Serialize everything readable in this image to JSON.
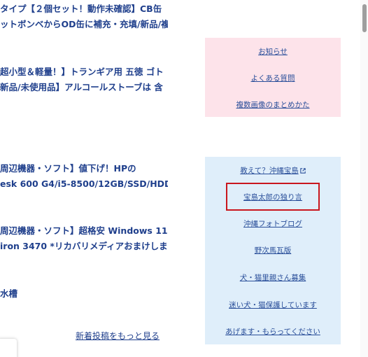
{
  "posts": [
    {
      "line1": "タイプ【２個セット！動作未確認】CB缶",
      "line2": "ットボンベからOD缶に補充・充填/新品/複"
    },
    {
      "line1": "超小型＆軽量！】トランギア用 五徳 ゴト",
      "line2": "新品/未使用品】アルコールストーブは 含"
    },
    {
      "line1": "周辺機器・ソフト】値下げ！HPの",
      "line2": "esk 600 G4/i5-8500/12GB/SSD/HDD"
    },
    {
      "line1": "周辺機器・ソフト】超格安 Windows 11フ",
      "line2": "iron 3470 *リカバリメディアおまけしま"
    },
    {
      "line1": "水槽",
      "line2": ""
    }
  ],
  "more_link": "新着投稿をもっと見る",
  "sidebar_pink": {
    "links": [
      "お知らせ",
      "よくある質問",
      "複数画像のまとめかた"
    ]
  },
  "sidebar_blue": {
    "links": [
      "教えて？沖縄宝島",
      "宝島太郎の独り言",
      "沖縄フォトブログ",
      "野次馬瓦版",
      "犬・猫里親さん募集",
      "迷い犬・猫保護しています",
      "あげます・もらってください"
    ]
  },
  "colors": {
    "link": "#1f3f8c",
    "pink_panel": "#fde3ea",
    "blue_panel": "#dfeefa",
    "highlight": "#c9161d"
  },
  "icons": {
    "external": "external-link-icon"
  }
}
